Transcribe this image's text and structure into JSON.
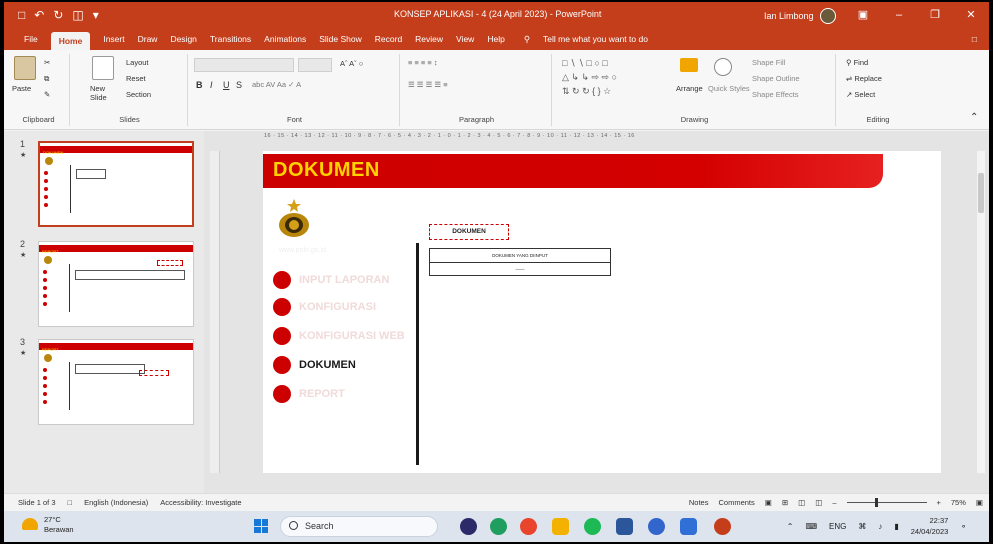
{
  "window": {
    "title": "KONSEP APLIKASI - 4 (24 April 2023) - PowerPoint",
    "user": "Ian Limbong",
    "qat": [
      "save",
      "undo",
      "redo",
      "present",
      "more"
    ]
  },
  "tabs": [
    "File",
    "Home",
    "Insert",
    "Draw",
    "Design",
    "Transitions",
    "Animations",
    "Slide Show",
    "Record",
    "Review",
    "View",
    "Help"
  ],
  "active_tab": "Home",
  "tell_me": "Tell me what you want to do",
  "ribbon": {
    "clipboard": {
      "paste": "Paste",
      "label": "Clipboard"
    },
    "slides": {
      "new_slide": "New Slide",
      "layout": "Layout",
      "reset": "Reset",
      "section": "Section",
      "label": "Slides"
    },
    "font": {
      "bold": "B",
      "italic": "I",
      "underline": "U",
      "strike": "S",
      "label": "Font"
    },
    "paragraph": {
      "label": "Paragraph"
    },
    "drawing": {
      "arrange": "Arrange",
      "quick_styles": "Quick Styles",
      "shape_fill": "Shape Fill",
      "shape_outline": "Shape Outline",
      "shape_effects": "Shape Effects",
      "label": "Drawing"
    },
    "editing": {
      "find": "Find",
      "replace": "Replace",
      "select": "Select",
      "label": "Editing"
    }
  },
  "ruler_text": "16 · 15 · 14 · 13 · 12 · 11 · 10 · 9 · 8 · 7 · 6 · 5 · 4 · 3 · 2 · 1 · 0 · 1 · 2 · 3 · 4 · 5 · 6 · 7 · 8 · 9 · 10 · 11 · 12 · 13 · 14 · 15 · 16",
  "thumbnails": [
    {
      "num": "1",
      "title": "DOKUMEN"
    },
    {
      "num": "2",
      "title": "REPORT"
    },
    {
      "num": "3",
      "title": "REPORT"
    }
  ],
  "slide": {
    "title": "DOKUMEN",
    "url": "www.polri.go.id",
    "nav": [
      {
        "label": "INPUT LAPORAN",
        "current": false
      },
      {
        "label": "KONFIGURASI",
        "current": false
      },
      {
        "label": "KONFIGURASI WEB",
        "current": false
      },
      {
        "label": "DOKUMEN",
        "current": true
      },
      {
        "label": "REPORT",
        "current": false
      }
    ],
    "doc_button": "DOKUMEN",
    "table_header": "DOKUMEN YANG DIINPUT",
    "table_cell": "——"
  },
  "status": {
    "slide_info": "Slide 1 of 3",
    "language": "English (Indonesia)",
    "accessibility": "Accessibility: Investigate",
    "notes": "Notes",
    "comments": "Comments",
    "zoom": "75%"
  },
  "taskbar": {
    "temp": "27°C",
    "weather": "Berawan",
    "search": "Search",
    "lang": "ENG",
    "time": "22:37",
    "date": "24/04/2023"
  },
  "colors": {
    "accent": "#c43e1c",
    "slide_red": "#cc0000",
    "slide_title": "#ffd200"
  }
}
